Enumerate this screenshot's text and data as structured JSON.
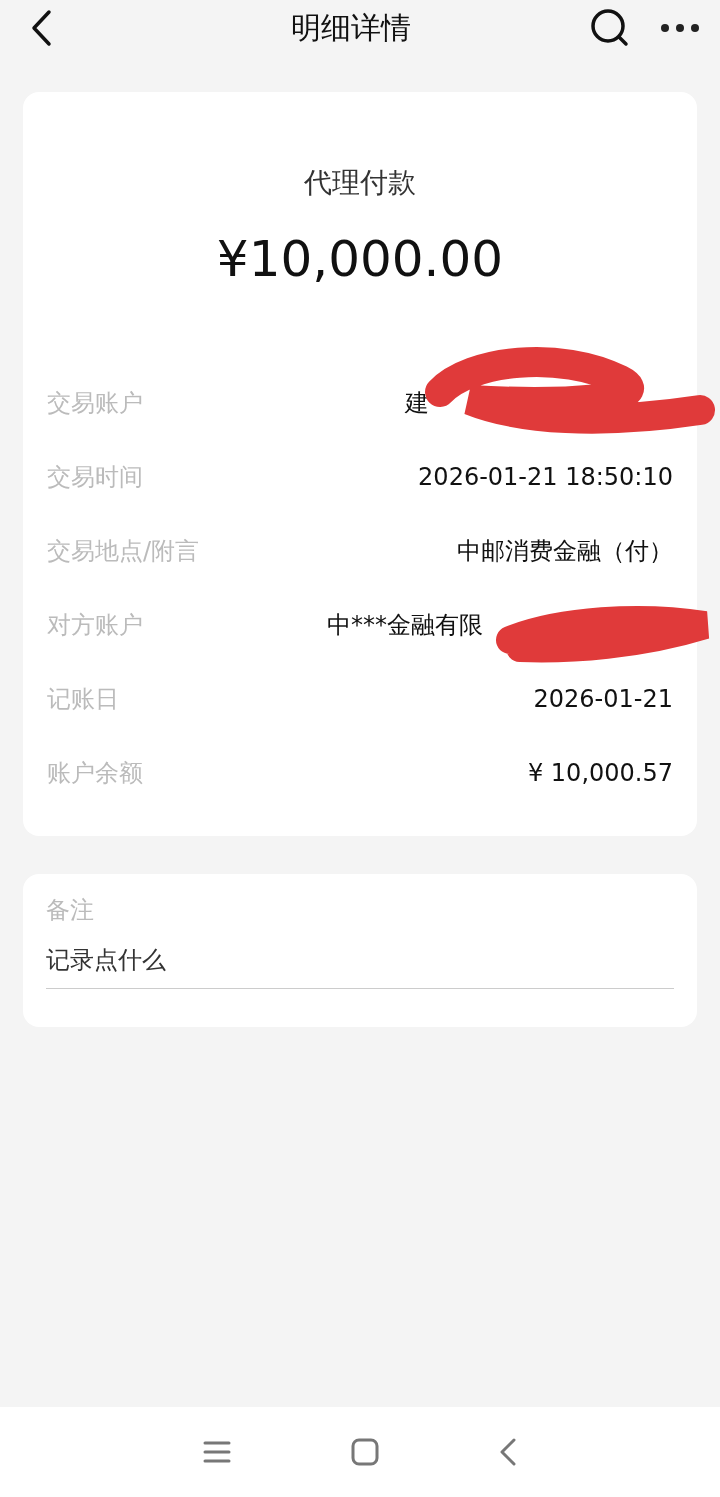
{
  "header": {
    "title": "明细详情"
  },
  "summary": {
    "type": "代理付款",
    "amount": "¥10,000.00"
  },
  "details": [
    {
      "label": "交易账户",
      "value": "建"
    },
    {
      "label": "交易时间",
      "value": "2026-01-21 18:50:10"
    },
    {
      "label": "交易地点/附言",
      "value": "中邮消费金融（付）"
    },
    {
      "label": "对方账户",
      "value": "中***金融有限"
    },
    {
      "label": "记账日",
      "value": "2026-01-21"
    },
    {
      "label": "账户余额",
      "value": "¥ 10,000.57"
    }
  ],
  "note": {
    "label": "备注",
    "placeholder": "记录点什么"
  }
}
